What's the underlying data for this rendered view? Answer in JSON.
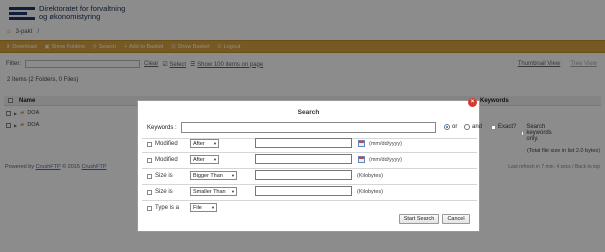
{
  "header": {
    "logo_line1": "Direktoratet for forvaltning",
    "logo_line2": "og økonomistyring",
    "brand_color": "#1c3a6b"
  },
  "breadcrumb": {
    "home": "3-pakt",
    "sep": "/"
  },
  "toolbar": {
    "color": "#d9a441",
    "items": [
      "Download",
      "Show Folders",
      "Search",
      "Add to Basket",
      "Show Basket",
      "Logout"
    ]
  },
  "filter": {
    "label": "Filter:",
    "value": "",
    "clear": "Clear",
    "select": "Select",
    "show_items": "Show 100 items on page",
    "thumbnail_view": "Thumbnail View",
    "tree_view": "Tree View"
  },
  "listing": {
    "count": "2 Items (2 Folders, 0 Files)",
    "col_name": "Name",
    "col_right": "Keywords",
    "rows": [
      {
        "name": "DOA"
      },
      {
        "name": "DOA"
      }
    ],
    "file_size": "(Total file size in list 2.0 bytes)"
  },
  "footer": {
    "powered_prefix": "Powered by",
    "powered_link": "CrushFTP",
    "copyright": "© 2015",
    "powered_link2": "CrushFTP",
    "logged_in": "Last refresh in 7 min, 4 secs / Back to top"
  },
  "search_dialog": {
    "title": "Search",
    "keywords_label": "Keywords :",
    "keywords_value": "",
    "or_label": "or",
    "and_label": "and",
    "exact_label": "Exact?",
    "only_kw_label": "Search keywords only.",
    "modified1": {
      "label": "Modified",
      "op": "After",
      "hint": "(mm/dd/yyyy)"
    },
    "modified2": {
      "label": "Modified",
      "op": "After",
      "hint": "(mm/dd/yyyy)"
    },
    "size1": {
      "label": "Size is",
      "op": "Bigger Than",
      "hint": "(Kilobytes)"
    },
    "size2": {
      "label": "Size is",
      "op": "Smaller Than",
      "hint": "(Kilobytes)"
    },
    "type": {
      "label": "Type is a",
      "op": "File"
    },
    "start_button": "Start Search",
    "cancel_button": "Cancel"
  }
}
